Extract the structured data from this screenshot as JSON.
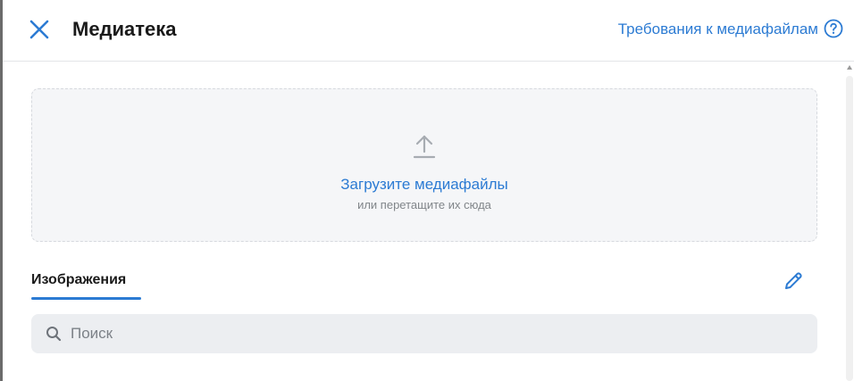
{
  "header": {
    "title": "Медиатека",
    "requirements_link": "Требования к медиафайлам",
    "close_icon": "close-icon",
    "help_icon": "question-circle-icon"
  },
  "dropzone": {
    "icon": "upload-arrow-icon",
    "title": "Загрузите медиафайлы",
    "subtitle": "или перетащите их сюда"
  },
  "tabs": [
    {
      "label": "Изображения",
      "active": true
    }
  ],
  "toolbar": {
    "edit_icon": "pencil-icon"
  },
  "search": {
    "placeholder": "Поиск",
    "value": "",
    "icon": "search-icon"
  },
  "colors": {
    "accent": "#2c7bd3",
    "text": "#1a1a1a",
    "muted": "#808589",
    "dropzone_bg": "#f5f6f8",
    "search_bg": "#eceef1"
  }
}
